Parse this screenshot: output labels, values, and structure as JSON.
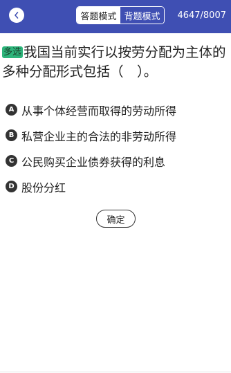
{
  "header": {
    "back_icon": "chevron-left-icon",
    "modes": {
      "answer_label": "答题模式",
      "recite_label": "背题模式",
      "active": "answer"
    },
    "progress": "4647/8007"
  },
  "question": {
    "type_badge": "多选",
    "text": "我国当前实行以按劳分配为主体的多种分配形式包括（　）。"
  },
  "options": [
    {
      "letter": "A",
      "text": "从事个体经营而取得的劳动所得"
    },
    {
      "letter": "B",
      "text": "私营企业主的合法的非劳动所得"
    },
    {
      "letter": "C",
      "text": "公民购买企业债券获得的利息"
    },
    {
      "letter": "D",
      "text": "股份分红"
    }
  ],
  "confirm_label": "确定",
  "colors": {
    "header_bg": "#3f4fb3",
    "badge_bg": "#2db57b",
    "option_circle": "#333333"
  }
}
